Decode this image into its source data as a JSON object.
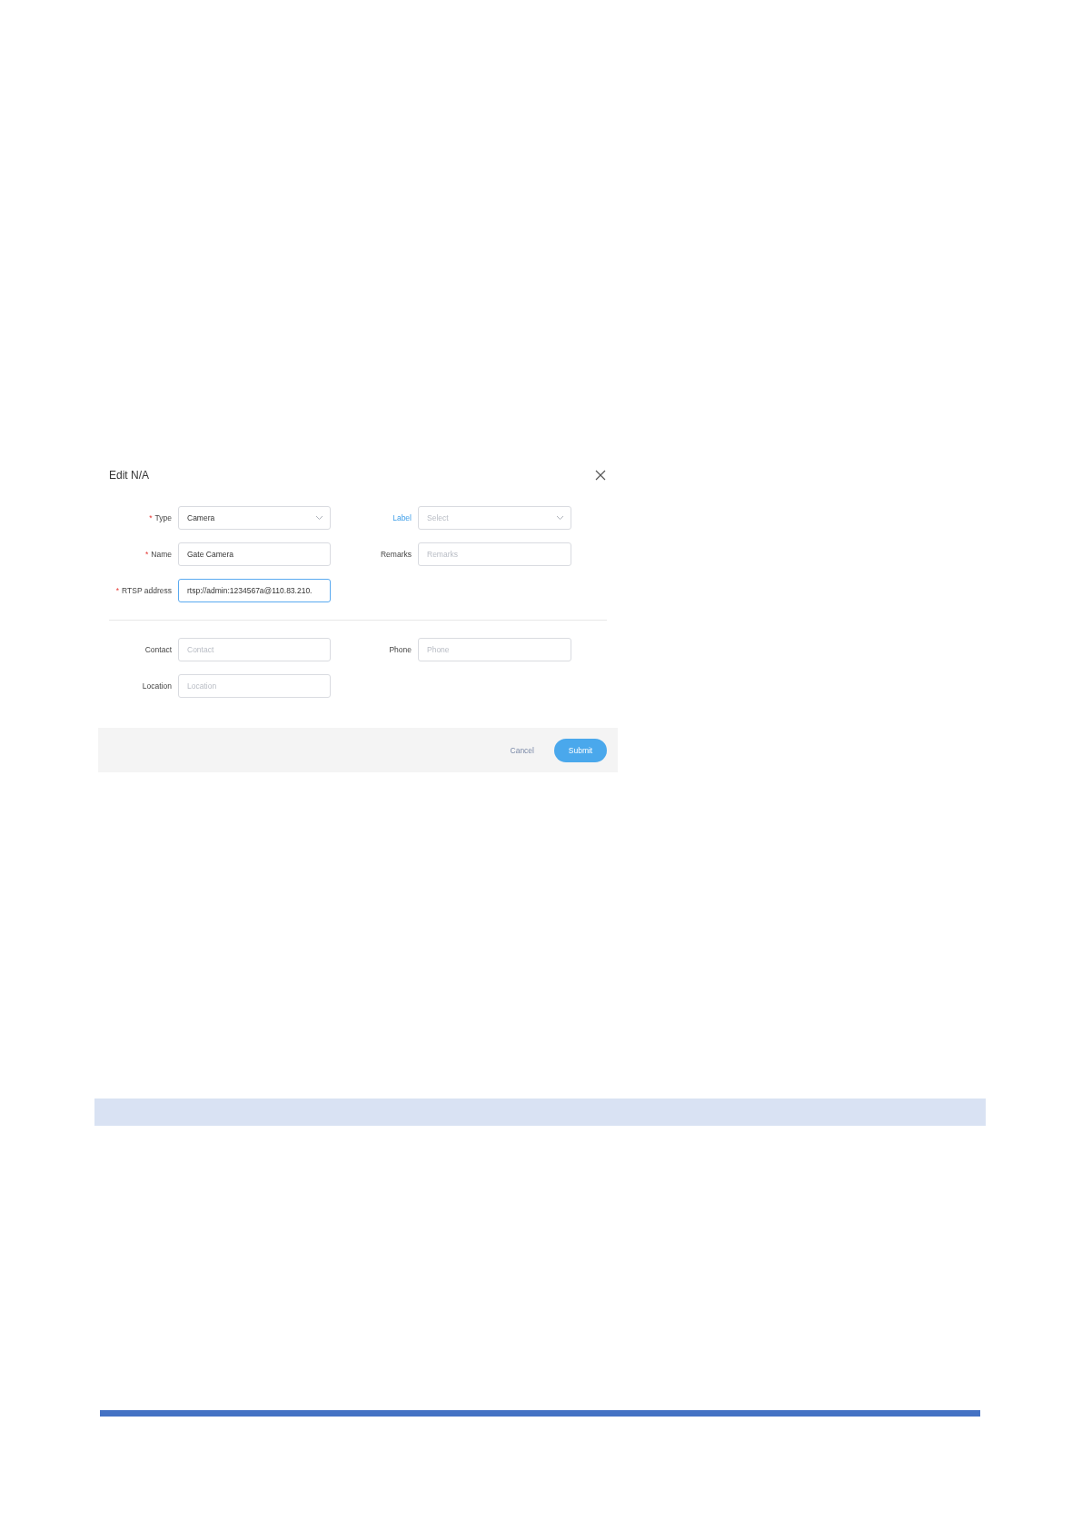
{
  "dialog": {
    "title": "Edit N/A",
    "sections": [
      {
        "rows": [
          {
            "left": {
              "label": "Type",
              "mark": "*",
              "kind": "select",
              "value": "Camera",
              "focused": false
            },
            "right": {
              "label": "Label",
              "highlighted": true,
              "kind": "select",
              "placeholder": "Select",
              "focused": false
            }
          },
          {
            "left": {
              "label": "Name",
              "mark": "*",
              "kind": "input",
              "value": "Gate Camera",
              "focused": false
            },
            "right": {
              "label": "Remarks",
              "kind": "input",
              "placeholder": "Remarks",
              "focused": false
            }
          },
          {
            "left": {
              "label": "RTSP address",
              "mark": "*",
              "kind": "input",
              "value": "rtsp://admin:1234567a@110.83.210.",
              "focused": true
            }
          }
        ]
      },
      {
        "rows": [
          {
            "left": {
              "label": "Contact",
              "kind": "input",
              "placeholder": "Contact",
              "focused": false
            },
            "right": {
              "label": "Phone",
              "kind": "input",
              "placeholder": "Phone",
              "focused": false
            }
          },
          {
            "left": {
              "label": "Location",
              "kind": "input",
              "placeholder": "Location",
              "focused": false
            }
          }
        ]
      }
    ],
    "footer": {
      "cancel": "Cancel",
      "submit": "Submit"
    }
  }
}
